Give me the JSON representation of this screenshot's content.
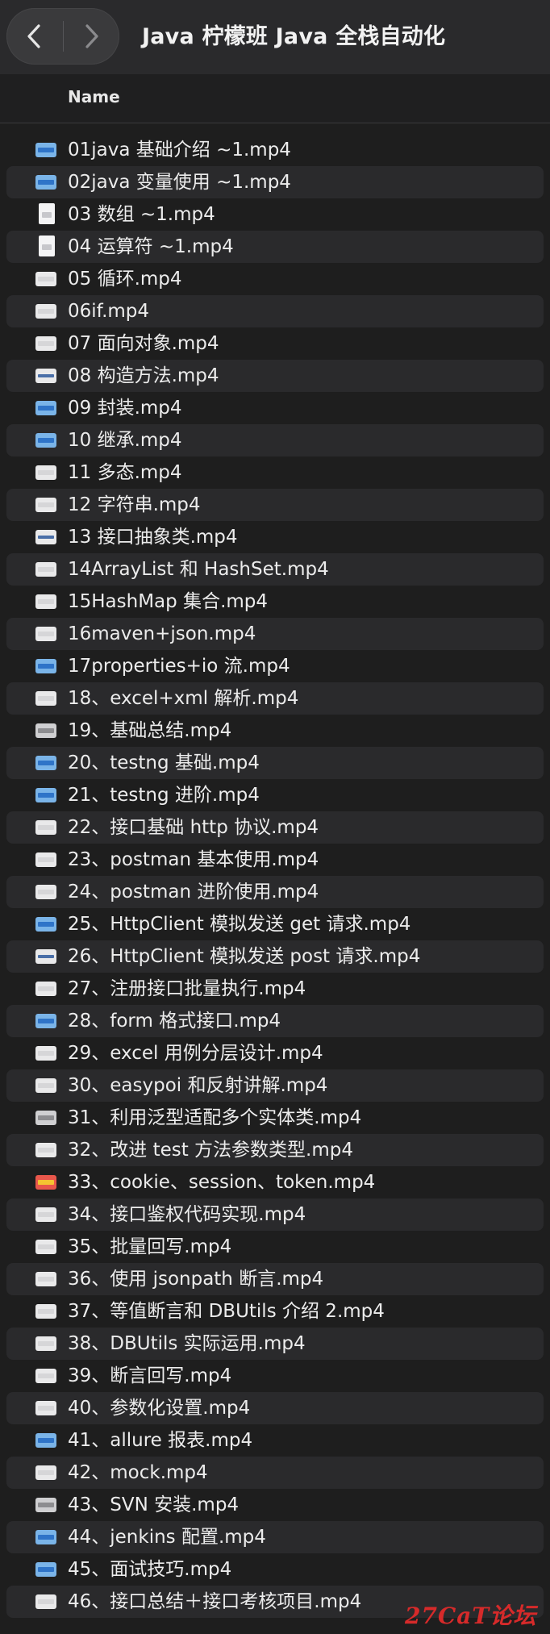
{
  "window": {
    "title": "Java 柠檬班 Java 全栈自动化",
    "back_icon": "chevron-left-icon",
    "forward_icon": "chevron-right-icon"
  },
  "columns": {
    "name_header": "Name"
  },
  "files": [
    {
      "name": "01java 基础介绍 ~1.mp4",
      "icon": "blue-thumb"
    },
    {
      "name": "02java 变量使用 ~1.mp4",
      "icon": "blue-thumb"
    },
    {
      "name": "03 数组 ~1.mp4",
      "icon": "document"
    },
    {
      "name": "04 运算符 ~1.mp4",
      "icon": "document"
    },
    {
      "name": "05 循环.mp4",
      "icon": "white-thumb"
    },
    {
      "name": "06if.mp4",
      "icon": "white-thumb"
    },
    {
      "name": "07 面向对象.mp4",
      "icon": "white-thumb"
    },
    {
      "name": "08 构造方法.mp4",
      "icon": "stripe-thumb"
    },
    {
      "name": "09 封装.mp4",
      "icon": "blue-thumb"
    },
    {
      "name": "10 继承.mp4",
      "icon": "blue-thumb"
    },
    {
      "name": "11 多态.mp4",
      "icon": "white-thumb"
    },
    {
      "name": "12 字符串.mp4",
      "icon": "white-thumb"
    },
    {
      "name": "13 接口抽象类.mp4",
      "icon": "stripe-thumb"
    },
    {
      "name": "14ArrayList 和 HashSet.mp4",
      "icon": "white-thumb"
    },
    {
      "name": "15HashMap 集合.mp4",
      "icon": "white-thumb"
    },
    {
      "name": "16maven+json.mp4",
      "icon": "white-thumb"
    },
    {
      "name": "17properties+io 流.mp4",
      "icon": "blue-thumb"
    },
    {
      "name": "18、excel+xml 解析.mp4",
      "icon": "white-thumb"
    },
    {
      "name": "19、基础总结.mp4",
      "icon": "gray-thumb"
    },
    {
      "name": "20、testng 基础.mp4",
      "icon": "blue-thumb"
    },
    {
      "name": "21、testng 进阶.mp4",
      "icon": "blue-thumb"
    },
    {
      "name": "22、接口基础 http 协议.mp4",
      "icon": "white-thumb"
    },
    {
      "name": "23、postman 基本使用.mp4",
      "icon": "white-thumb"
    },
    {
      "name": "24、postman 进阶使用.mp4",
      "icon": "white-thumb"
    },
    {
      "name": "25、HttpClient 模拟发送 get 请求.mp4",
      "icon": "blue-thumb"
    },
    {
      "name": "26、HttpClient 模拟发送 post 请求.mp4",
      "icon": "stripe-thumb"
    },
    {
      "name": "27、注册接口批量执行.mp4",
      "icon": "white-thumb"
    },
    {
      "name": "28、form 格式接口.mp4",
      "icon": "blue-thumb"
    },
    {
      "name": "29、excel 用例分层设计.mp4",
      "icon": "white-thumb"
    },
    {
      "name": "30、easypoi 和反射讲解.mp4",
      "icon": "white-thumb"
    },
    {
      "name": "31、利用泛型适配多个实体类.mp4",
      "icon": "gray-thumb"
    },
    {
      "name": "32、改进 test 方法参数类型.mp4",
      "icon": "white-thumb"
    },
    {
      "name": "33、cookie、session、token.mp4",
      "icon": "red-thumb"
    },
    {
      "name": "34、接口鉴权代码实现.mp4",
      "icon": "white-thumb"
    },
    {
      "name": "35、批量回写.mp4",
      "icon": "white-thumb"
    },
    {
      "name": "36、使用 jsonpath 断言.mp4",
      "icon": "white-thumb"
    },
    {
      "name": "37、等值断言和 DBUtils 介绍 2.mp4",
      "icon": "white-thumb"
    },
    {
      "name": "38、DBUtils 实际运用.mp4",
      "icon": "white-thumb"
    },
    {
      "name": "39、断言回写.mp4",
      "icon": "white-thumb"
    },
    {
      "name": "40、参数化设置.mp4",
      "icon": "white-thumb"
    },
    {
      "name": "41、allure 报表.mp4",
      "icon": "blue-thumb"
    },
    {
      "name": "42、mock.mp4",
      "icon": "white-thumb"
    },
    {
      "name": "43、SVN 安装.mp4",
      "icon": "gray-thumb"
    },
    {
      "name": "44、jenkins 配置.mp4",
      "icon": "blue-thumb"
    },
    {
      "name": "45、面试技巧.mp4",
      "icon": "blue-thumb"
    },
    {
      "name": "46、接口总结＋接口考核项目.mp4",
      "icon": "white-thumb"
    }
  ],
  "watermark": "27CaT论坛"
}
